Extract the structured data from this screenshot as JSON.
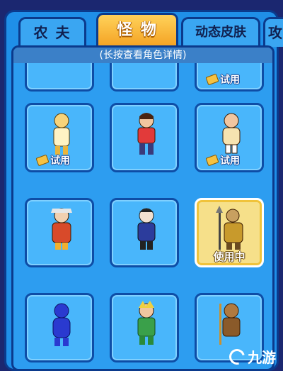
{
  "tabs": [
    {
      "label": "农 夫",
      "active": false
    },
    {
      "label": "怪 物",
      "active": true
    },
    {
      "label": "动态皮肤",
      "active": false
    },
    {
      "label": "攻",
      "active": false
    }
  ],
  "hint": "(长按查看角色详情)",
  "cards": [
    {
      "id": "r0c0",
      "trial_label": ""
    },
    {
      "id": "r0c1",
      "trial_label": ""
    },
    {
      "id": "r0c2",
      "trial_label": "试用"
    },
    {
      "id": "r1c0",
      "trial_label": "试用"
    },
    {
      "id": "r1c1",
      "trial_label": ""
    },
    {
      "id": "r1c2",
      "trial_label": "试用"
    },
    {
      "id": "r2c0",
      "trial_label": ""
    },
    {
      "id": "r2c1",
      "trial_label": ""
    },
    {
      "id": "r2c2",
      "trial_label": "",
      "status": "使用中"
    },
    {
      "id": "r3c0",
      "trial_label": ""
    },
    {
      "id": "r3c1",
      "trial_label": ""
    },
    {
      "id": "r3c2",
      "trial_label": ""
    }
  ],
  "watermark": "九游",
  "colors": {
    "accent": "#f4a223",
    "panel": "#2d9df0",
    "card": "#49b6fb",
    "selected": "#f6e08a"
  }
}
